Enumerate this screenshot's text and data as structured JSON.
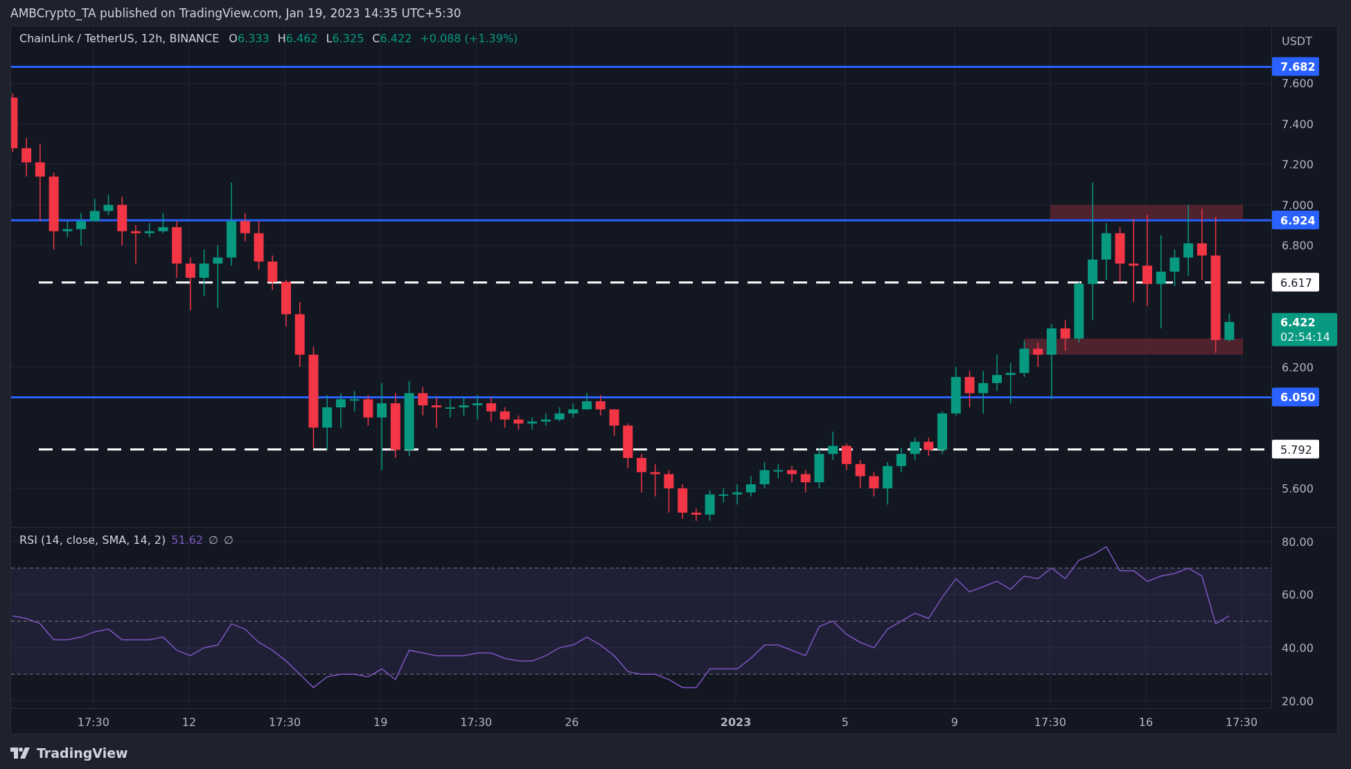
{
  "header": {
    "text": "AMBCrypto_TA published on TradingView.com, Jan 19, 2023 14:35 UTC+5:30"
  },
  "legend": {
    "symbol": "ChainLink / TetherUS, 12h, BINANCE",
    "values": [
      {
        "key": "O",
        "value": "6.333"
      },
      {
        "key": "H",
        "value": "6.462"
      },
      {
        "key": "L",
        "value": "6.325"
      },
      {
        "key": "C",
        "value": "6.422"
      }
    ],
    "change": "+0.088 (+1.39%)"
  },
  "price_axis": {
    "unit": "USDT"
  },
  "main_chart": {
    "price_tag": {
      "price": "6.422",
      "countdown": "02:54:14"
    },
    "chart_data": {
      "type": "candlestick",
      "grid": true,
      "ylim": [
        5.408,
        7.882
      ],
      "ref_lines": [
        {
          "axis": "y",
          "value": 7.682,
          "label": "7.682",
          "color": "#2962ff"
        },
        {
          "axis": "y",
          "value": 6.924,
          "label": "6.924",
          "color": "#2962ff"
        },
        {
          "axis": "y",
          "value": 6.617,
          "label": "6.617",
          "color": "#ffffff"
        },
        {
          "axis": "y",
          "value": 6.05,
          "label": "6.050",
          "color": "#2962ff"
        },
        {
          "axis": "y",
          "value": 5.792,
          "label": "5.792",
          "color": "#ffffff"
        }
      ],
      "yticks": [
        {
          "value": 5.6,
          "label": "5.600"
        },
        {
          "value": 6.2,
          "label": "6.200"
        },
        {
          "value": 6.8,
          "label": "6.800"
        },
        {
          "value": 7.0,
          "label": "7.000"
        },
        {
          "value": 7.2,
          "label": "7.200"
        },
        {
          "value": 7.4,
          "label": "7.400"
        },
        {
          "value": 7.6,
          "label": "7.600"
        }
      ],
      "ohlc": [
        [
          7.53,
          7.55,
          7.26,
          7.28
        ],
        [
          7.28,
          7.33,
          7.14,
          7.21
        ],
        [
          7.21,
          7.3,
          6.92,
          7.14
        ],
        [
          7.14,
          7.16,
          6.78,
          6.87
        ],
        [
          6.87,
          6.92,
          6.84,
          6.88
        ],
        [
          6.88,
          6.96,
          6.8,
          6.92
        ],
        [
          6.92,
          7.03,
          6.92,
          6.97
        ],
        [
          6.97,
          7.05,
          6.95,
          7.0
        ],
        [
          7.0,
          7.04,
          6.8,
          6.87
        ],
        [
          6.87,
          6.9,
          6.71,
          6.86
        ],
        [
          6.86,
          6.91,
          6.84,
          6.87
        ],
        [
          6.87,
          6.96,
          6.86,
          6.89
        ],
        [
          6.89,
          6.92,
          6.64,
          6.71
        ],
        [
          6.71,
          6.74,
          6.48,
          6.64
        ],
        [
          6.64,
          6.78,
          6.55,
          6.71
        ],
        [
          6.71,
          6.8,
          6.49,
          6.74
        ],
        [
          6.74,
          7.11,
          6.7,
          6.92
        ],
        [
          6.92,
          6.96,
          6.82,
          6.86
        ],
        [
          6.86,
          6.92,
          6.68,
          6.72
        ],
        [
          6.72,
          6.75,
          6.58,
          6.62
        ],
        [
          6.62,
          6.63,
          6.4,
          6.46
        ],
        [
          6.46,
          6.52,
          6.2,
          6.26
        ],
        [
          6.26,
          6.3,
          5.8,
          5.9
        ],
        [
          5.9,
          6.06,
          5.79,
          6.0
        ],
        [
          6.0,
          6.07,
          5.9,
          6.04
        ],
        [
          6.04,
          6.08,
          5.98,
          6.04
        ],
        [
          6.04,
          6.06,
          5.91,
          5.95
        ],
        [
          5.95,
          6.12,
          5.69,
          6.02
        ],
        [
          6.02,
          6.07,
          5.75,
          5.79
        ],
        [
          5.79,
          6.13,
          5.76,
          6.07
        ],
        [
          6.07,
          6.1,
          5.96,
          6.01
        ],
        [
          6.01,
          6.05,
          5.9,
          6.0
        ],
        [
          6.0,
          6.04,
          5.95,
          6.0
        ],
        [
          6.0,
          6.05,
          5.96,
          6.01
        ],
        [
          6.01,
          6.06,
          5.94,
          6.02
        ],
        [
          6.02,
          6.05,
          5.93,
          5.98
        ],
        [
          5.98,
          6.0,
          5.9,
          5.94
        ],
        [
          5.94,
          5.96,
          5.89,
          5.92
        ],
        [
          5.92,
          5.95,
          5.89,
          5.93
        ],
        [
          5.93,
          5.97,
          5.91,
          5.94
        ],
        [
          5.94,
          6.0,
          5.93,
          5.97
        ],
        [
          5.97,
          6.02,
          5.95,
          5.99
        ],
        [
          5.99,
          6.07,
          5.99,
          6.03
        ],
        [
          6.03,
          6.06,
          5.96,
          5.99
        ],
        [
          5.99,
          5.99,
          5.86,
          5.91
        ],
        [
          5.91,
          5.92,
          5.7,
          5.75
        ],
        [
          5.75,
          5.77,
          5.58,
          5.68
        ],
        [
          5.68,
          5.72,
          5.56,
          5.67
        ],
        [
          5.67,
          5.69,
          5.48,
          5.6
        ],
        [
          5.6,
          5.62,
          5.45,
          5.48
        ],
        [
          5.48,
          5.5,
          5.44,
          5.47
        ],
        [
          5.47,
          5.59,
          5.44,
          5.57
        ],
        [
          5.57,
          5.6,
          5.53,
          5.57
        ],
        [
          5.57,
          5.62,
          5.52,
          5.58
        ],
        [
          5.58,
          5.66,
          5.56,
          5.62
        ],
        [
          5.62,
          5.73,
          5.6,
          5.69
        ],
        [
          5.69,
          5.72,
          5.65,
          5.69
        ],
        [
          5.69,
          5.71,
          5.63,
          5.67
        ],
        [
          5.67,
          5.69,
          5.58,
          5.63
        ],
        [
          5.63,
          5.8,
          5.6,
          5.77
        ],
        [
          5.77,
          5.88,
          5.74,
          5.81
        ],
        [
          5.81,
          5.82,
          5.69,
          5.72
        ],
        [
          5.72,
          5.74,
          5.6,
          5.66
        ],
        [
          5.66,
          5.68,
          5.56,
          5.6
        ],
        [
          5.6,
          5.73,
          5.52,
          5.71
        ],
        [
          5.71,
          5.8,
          5.68,
          5.77
        ],
        [
          5.77,
          5.85,
          5.74,
          5.83
        ],
        [
          5.83,
          5.85,
          5.76,
          5.79
        ],
        [
          5.79,
          5.98,
          5.77,
          5.97
        ],
        [
          5.97,
          6.2,
          5.96,
          6.15
        ],
        [
          6.15,
          6.18,
          6.0,
          6.07
        ],
        [
          6.07,
          6.18,
          5.97,
          6.12
        ],
        [
          6.12,
          6.26,
          6.08,
          6.16
        ],
        [
          6.16,
          6.22,
          6.02,
          6.17
        ],
        [
          6.17,
          6.33,
          6.15,
          6.29
        ],
        [
          6.29,
          6.32,
          6.2,
          6.26
        ],
        [
          6.26,
          6.41,
          6.04,
          6.39
        ],
        [
          6.39,
          6.43,
          6.28,
          6.34
        ],
        [
          6.34,
          6.62,
          6.32,
          6.61
        ],
        [
          6.61,
          7.11,
          6.43,
          6.73
        ],
        [
          6.73,
          6.91,
          6.63,
          6.86
        ],
        [
          6.86,
          6.89,
          6.62,
          6.71
        ],
        [
          6.71,
          6.93,
          6.52,
          6.7
        ],
        [
          6.7,
          6.95,
          6.5,
          6.61
        ],
        [
          6.61,
          6.85,
          6.39,
          6.67
        ],
        [
          6.67,
          6.78,
          6.6,
          6.74
        ],
        [
          6.74,
          7.0,
          6.65,
          6.81
        ],
        [
          6.81,
          6.98,
          6.63,
          6.75
        ],
        [
          6.75,
          6.94,
          6.27,
          6.333
        ],
        [
          6.333,
          6.462,
          6.325,
          6.422
        ]
      ]
    }
  },
  "rsi": {
    "name": "RSI (14, close, SMA, 14, 2)",
    "value": "51.62",
    "extras": [
      "∅",
      "∅"
    ],
    "chart_data": {
      "type": "line",
      "grid": true,
      "ylim": [
        17.26,
        85.14
      ],
      "categories": [
        null,
        null,
        null,
        null,
        null,
        null,
        "17:30",
        null,
        null,
        null,
        null,
        null,
        null,
        "12",
        null,
        null,
        null,
        null,
        null,
        null,
        "17:30",
        null,
        null,
        null,
        null,
        null,
        null,
        "19",
        null,
        null,
        null,
        null,
        null,
        null,
        "17:30",
        null,
        null,
        null,
        null,
        null,
        null,
        "26",
        null,
        null,
        null,
        null,
        null,
        null,
        null,
        null,
        null,
        null,
        null,
        "2023",
        null,
        null,
        null,
        null,
        null,
        null,
        null,
        "5",
        null,
        null,
        null,
        null,
        null,
        null,
        null,
        "9",
        null,
        null,
        null,
        null,
        null,
        null,
        "17:30",
        null,
        null,
        null,
        null,
        null,
        null,
        "16",
        null,
        null,
        null,
        null,
        null,
        null,
        "17:30"
      ],
      "yticks": [
        {
          "value": 20,
          "label": "20.00"
        },
        {
          "value": 40,
          "label": "40.00"
        },
        {
          "value": 60,
          "label": "60.00"
        },
        {
          "value": 80,
          "label": "80.00"
        }
      ],
      "values": [
        52,
        51,
        49,
        43,
        43,
        44,
        46,
        47,
        43,
        43,
        43,
        44,
        39,
        37,
        40,
        41,
        49,
        47,
        42,
        39,
        35,
        30,
        25,
        29,
        30,
        30,
        29,
        32,
        28,
        39,
        38,
        37,
        37,
        37,
        38,
        38,
        36,
        35,
        35,
        37,
        40,
        41,
        44,
        41,
        37,
        31,
        30,
        30,
        28,
        25,
        25,
        32,
        32,
        32,
        36,
        41,
        41,
        39,
        37,
        48,
        50,
        45,
        42,
        40,
        47,
        50,
        53,
        51,
        59,
        66,
        61,
        63,
        65,
        62,
        67,
        66,
        70,
        66,
        73,
        75,
        78,
        69,
        69,
        65,
        67,
        68,
        70,
        67,
        49,
        52,
        null
      ]
    }
  },
  "footer": {
    "brand": "TradingView"
  }
}
